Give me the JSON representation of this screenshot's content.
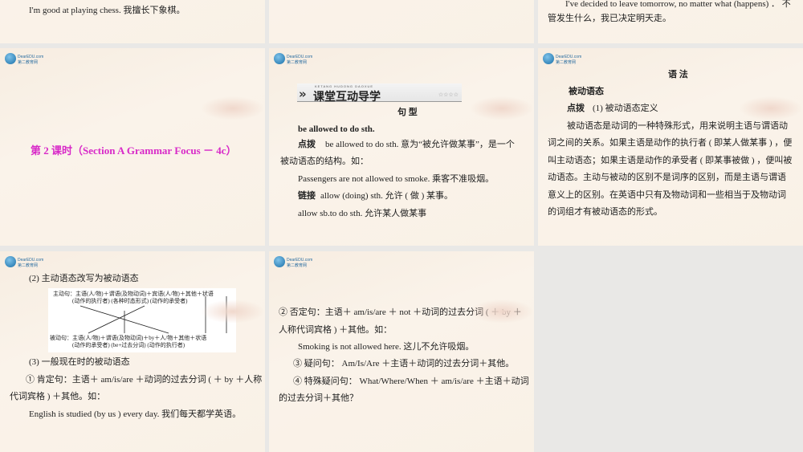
{
  "slides": [
    {
      "lines": [
        "I'm good at playing chess. 我擅长下象棋。"
      ]
    },
    {
      "lines": []
    },
    {
      "lines": [
        "I've decided to leave tomorrow, no matter what (happens) ． 不",
        "管发生什么，我已决定明天走。"
      ]
    },
    {
      "logo": "DearEDU.com 第二教育网",
      "title": "第 2 课时（Section A Grammar Focus － 4c）"
    },
    {
      "logo": "DearEDU.com 第二教育网",
      "banner_kicker": "KETANG HUDONG DAOXUE",
      "banner_title": "课堂互动导学",
      "banner_stars": "☆☆☆☆",
      "heading": "句 型",
      "lines": [
        "be allowed to do sth.",
        "点拨",
        "be allowed to do sth. 意为“被允许做某事”，是一个",
        "被动语态的结构。如：",
        "Passengers are not allowed to smoke. 乘客不准吸烟。",
        "链接",
        "allow (doing) sth. 允许 ( 做 ) 某事。",
        "allow sb.to do sth. 允许某人做某事"
      ]
    },
    {
      "logo": "DearEDU.com 第二教育网",
      "heading": "语 法",
      "lines": [
        "被动语态",
        "点拨",
        "(1) 被动语态定义",
        "被动语态是动词的一种特殊形式，用来说明主语与谓语动",
        "词之间的关系。如果主语是动作的执行者 ( 即某人做某事 ) ，便",
        "叫主动语态；如果主语是动作的承受者 ( 即某事被做 ) ，便叫被",
        "动语态。主动与被动的区别不是词序的区别，而是主语与谓语",
        "意义上的区别。在英语中只有及物动词和一些相当于及物动词",
        "的词组才有被动语态的形式。"
      ]
    },
    {
      "logo": "DearEDU.com 第二教育网",
      "lines": [
        "(2) 主动语态改写为被动语态",
        "(3) 一般现在时的被动语态",
        "① 肯定句：主语＋ am/is/are ＋动词的过去分词 ( ＋ by ＋人称",
        "代词宾格 ) ＋其他。如：",
        "English is studied (by us ) every day. 我们每天都学英语。"
      ],
      "diagram": [
        "主动句：主语(人/物)＋谓语(及物动词)＋宾语(人/物)＋其他＋状语",
        "(动作的执行者) (各种时态形式)  (动作的承受者)",
        "被动句：主语(人/物)＋谓语(及物动词)＋by＋人/物＋其他＋状语",
        "(动作的承受者) (be+过去分词)   (动作的执行者)"
      ]
    },
    {
      "logo": "DearEDU.com 第二教育网",
      "lines": [
        "② 否定句：主语＋ am/is/are ＋ not ＋动词的过去分词 ( ＋ by ＋",
        "人称代词宾格 ) ＋其他。如：",
        "Smoking is not allowed here. 这儿不允许吸烟。",
        "③ 疑问句： Am/Is/Are ＋主语＋动词的过去分词＋其他。",
        "④ 特殊疑问句： What/Where/When ＋ am/is/are ＋主语＋动词",
        "的过去分词＋其他？"
      ]
    }
  ]
}
